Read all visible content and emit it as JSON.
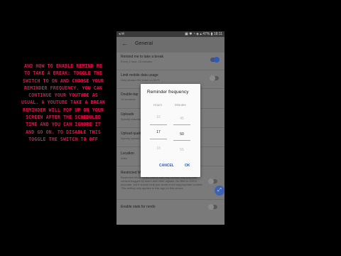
{
  "caption": "AND HOW TO ENABLE REMIND ME TO TAKE A BREAK: TOGGLE THE SWITCH TO ON AND CHOOSE YOUR REMINDER FREQUENCY. YOU CAN CONTINUE YOUR YOUTUBE AS USUAL. A YOUTUBE TAKE A BREAK REMINDER WILL POP UP ON YOUR SCREEN AFTER THE SCHEDULED TIME AND YOU CAN IGNORE IT AND GO ON. TO DISABLE THIS TOGGLE THE SWITCH TO OFF",
  "statusbar": {
    "left": "◂ ✉",
    "right": "▣ ✱ ◔ ◈ ▴ 47% ▮ 18:11"
  },
  "appbar": {
    "title": "General"
  },
  "settings": [
    {
      "title": "Remind me to take a break",
      "subtitle": "Every 1 hour, 15 minutes",
      "toggle": true
    },
    {
      "title": "Limit mobile data usage",
      "subtitle": "Only stream HD video on Wi-Fi",
      "toggle": false
    },
    {
      "title": "Double-tap",
      "subtitle": "10 seconds",
      "toggle": null
    },
    {
      "title": "Uploads",
      "subtitle": "Specify network preferences",
      "toggle": null
    },
    {
      "title": "Upload quality",
      "subtitle": "Specify upload quality",
      "toggle": null
    },
    {
      "title": "Location",
      "subtitle": "India",
      "toggle": null
    },
    {
      "title": "Restricted Mode",
      "subtitle": "Restricted Mode hides videos that may contain inappropriate content flagged by users and other signals. No filter is 100% accurate, but it should help you avoid most inappropriate content. This setting only applies to this app on this device.",
      "toggle": false
    },
    {
      "title": "Enable stats for nerds",
      "subtitle": "",
      "toggle": false
    }
  ],
  "dialog": {
    "title": "Reminder frequency",
    "hours_label": "Hours",
    "minutes_label": "Minutes",
    "hours": {
      "above": "16",
      "selected": "17",
      "below": "18"
    },
    "minutes": {
      "above": "45",
      "selected": "50",
      "below": "55"
    },
    "cancel": "CANCEL",
    "ok": "OK"
  },
  "icons": {
    "back": "arrow-left-icon",
    "fab": "expand-icon"
  }
}
